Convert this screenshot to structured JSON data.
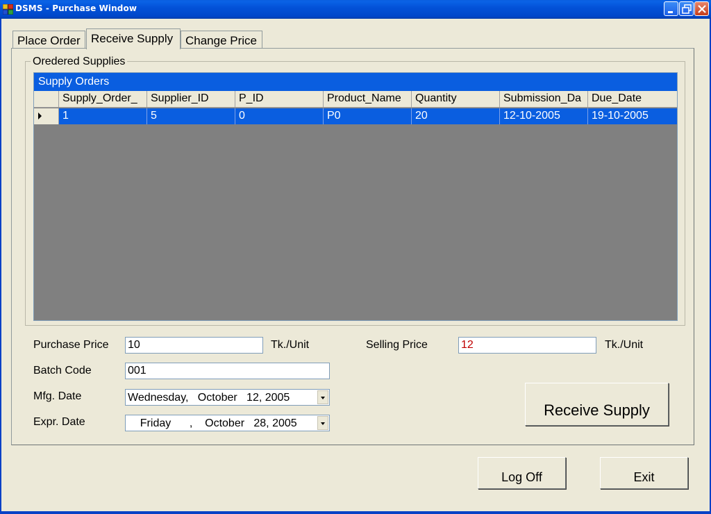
{
  "window": {
    "title": "DSMS - Purchase Window"
  },
  "tabs": [
    {
      "label": "Place Order"
    },
    {
      "label": "Receive Supply"
    },
    {
      "label": "Change Price"
    }
  ],
  "active_tab": "Receive Supply",
  "supplies_group": {
    "title": "Oredered Supplies"
  },
  "grid": {
    "caption": "Supply Orders",
    "columns": [
      "Supply_Order_",
      "Supplier_ID",
      "P_ID",
      "Product_Name",
      "Quantity",
      "Submission_Da",
      "Due_Date"
    ],
    "rows": [
      [
        "1",
        "5",
        "0",
        "P0",
        "20",
        "12-10-2005",
        "19-10-2005"
      ]
    ],
    "selected_row": 0
  },
  "form": {
    "purchase_price_label": "Purchase Price",
    "purchase_price_value": "10",
    "purchase_price_unit": "Tk./Unit",
    "selling_price_label": "Selling Price",
    "selling_price_value": "12",
    "selling_price_unit": "Tk./Unit",
    "batch_code_label": "Batch Code",
    "batch_code_value": "001",
    "mfg_date_label": "Mfg. Date",
    "mfg_date_value": "Wednesday,   October   12, 2005",
    "expr_date_label": "Expr. Date",
    "expr_date_value": "    Friday      ,    October   28, 2005"
  },
  "buttons": {
    "receive_supply": "Receive Supply",
    "log_off": "Log Off",
    "exit": "Exit"
  },
  "colors": {
    "selection": "#0a5ee0",
    "grid_background": "#808080",
    "selling_price_text": "#c00000",
    "window_face": "#ece9d8"
  }
}
